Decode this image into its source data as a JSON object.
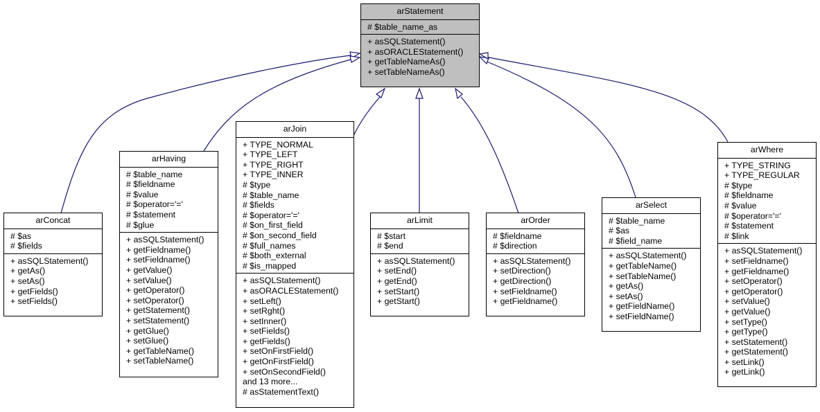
{
  "diagram": {
    "type": "class-inheritance",
    "edge_color": "#191970",
    "base_fill": "#bfbfbf",
    "base_class": {
      "name": "arStatement",
      "attributes": [
        "# $table_name_as"
      ],
      "methods": [
        "+ asSQLStatement()",
        "+ asORACLEStatement()",
        "+ getTableNameAs()",
        "+ setTableNameAs()"
      ]
    },
    "subclasses": [
      {
        "id": "arConcat",
        "name": "arConcat",
        "attributes": [
          "# $as",
          "# $fields"
        ],
        "methods": [
          "+ asSQLStatement()",
          "+ getAs()",
          "+ setAs()",
          "+ getFields()",
          "+ setFields()"
        ]
      },
      {
        "id": "arHaving",
        "name": "arHaving",
        "attributes": [
          "# $table_name",
          "# $fieldname",
          "# $value",
          "# $operator='='",
          "# $statement",
          "# $glue"
        ],
        "methods": [
          "+ asSQLStatement()",
          "+ getFieldname()",
          "+ setFieldname()",
          "+ getValue()",
          "+ setValue()",
          "+ getOperator()",
          "+ setOperator()",
          "+ getStatement()",
          "+ setStatement()",
          "+ getGlue()",
          "+ setGlue()",
          "+ getTableName()",
          "+ setTableName()"
        ]
      },
      {
        "id": "arJoin",
        "name": "arJoin",
        "attributes": [
          "+ TYPE_NORMAL",
          "+ TYPE_LEFT",
          "+ TYPE_RIGHT",
          "+ TYPE_INNER",
          "# $type",
          "# $table_name",
          "# $fields",
          "# $operator='='",
          "# $on_first_field",
          "# $on_second_field",
          "# $full_names",
          "# $both_external",
          "# $is_mapped"
        ],
        "methods": [
          "+ asSQLStatement()",
          "+ asORACLEStatement()",
          "+ setLeft()",
          "+ setRght()",
          "+ setInner()",
          "+ setFields()",
          "+ getFields()",
          "+ setOnFirstField()",
          "+ getOnFirstField()",
          "+ setOnSecondField()",
          "and 13 more...",
          "# asStatementText()"
        ]
      },
      {
        "id": "arLimit",
        "name": "arLimit",
        "attributes": [
          "# $start",
          "# $end"
        ],
        "methods": [
          "+ asSQLStatement()",
          "+ setEnd()",
          "+ getEnd()",
          "+ setStart()",
          "+ getStart()"
        ]
      },
      {
        "id": "arOrder",
        "name": "arOrder",
        "attributes": [
          "# $fieldname",
          "# $direction"
        ],
        "methods": [
          "+ asSQLStatement()",
          "+ setDirection()",
          "+ getDirection()",
          "+ setFieldname()",
          "+ getFieldname()"
        ]
      },
      {
        "id": "arSelect",
        "name": "arSelect",
        "attributes": [
          "# $table_name",
          "# $as",
          "# $field_name"
        ],
        "methods": [
          "+ asSQLStatement()",
          "+ getTableName()",
          "+ setTableName()",
          "+ getAs()",
          "+ setAs()",
          "+ getFieldName()",
          "+ setFieldName()"
        ]
      },
      {
        "id": "arWhere",
        "name": "arWhere",
        "attributes": [
          "+ TYPE_STRING",
          "+ TYPE_REGULAR",
          "# $type",
          "# $fieldname",
          "# $value",
          "# $operator='='",
          "# $statement",
          "# $link"
        ],
        "methods": [
          "+ asSQLStatement()",
          "+ setFieldname()",
          "+ getFieldname()",
          "+ setOperator()",
          "+ getOperator()",
          "+ setValue()",
          "+ getValue()",
          "+ setType()",
          "+ getType()",
          "+ setStatement()",
          "+ getStatement()",
          "+ setLink()",
          "+ getLink()"
        ]
      }
    ]
  }
}
